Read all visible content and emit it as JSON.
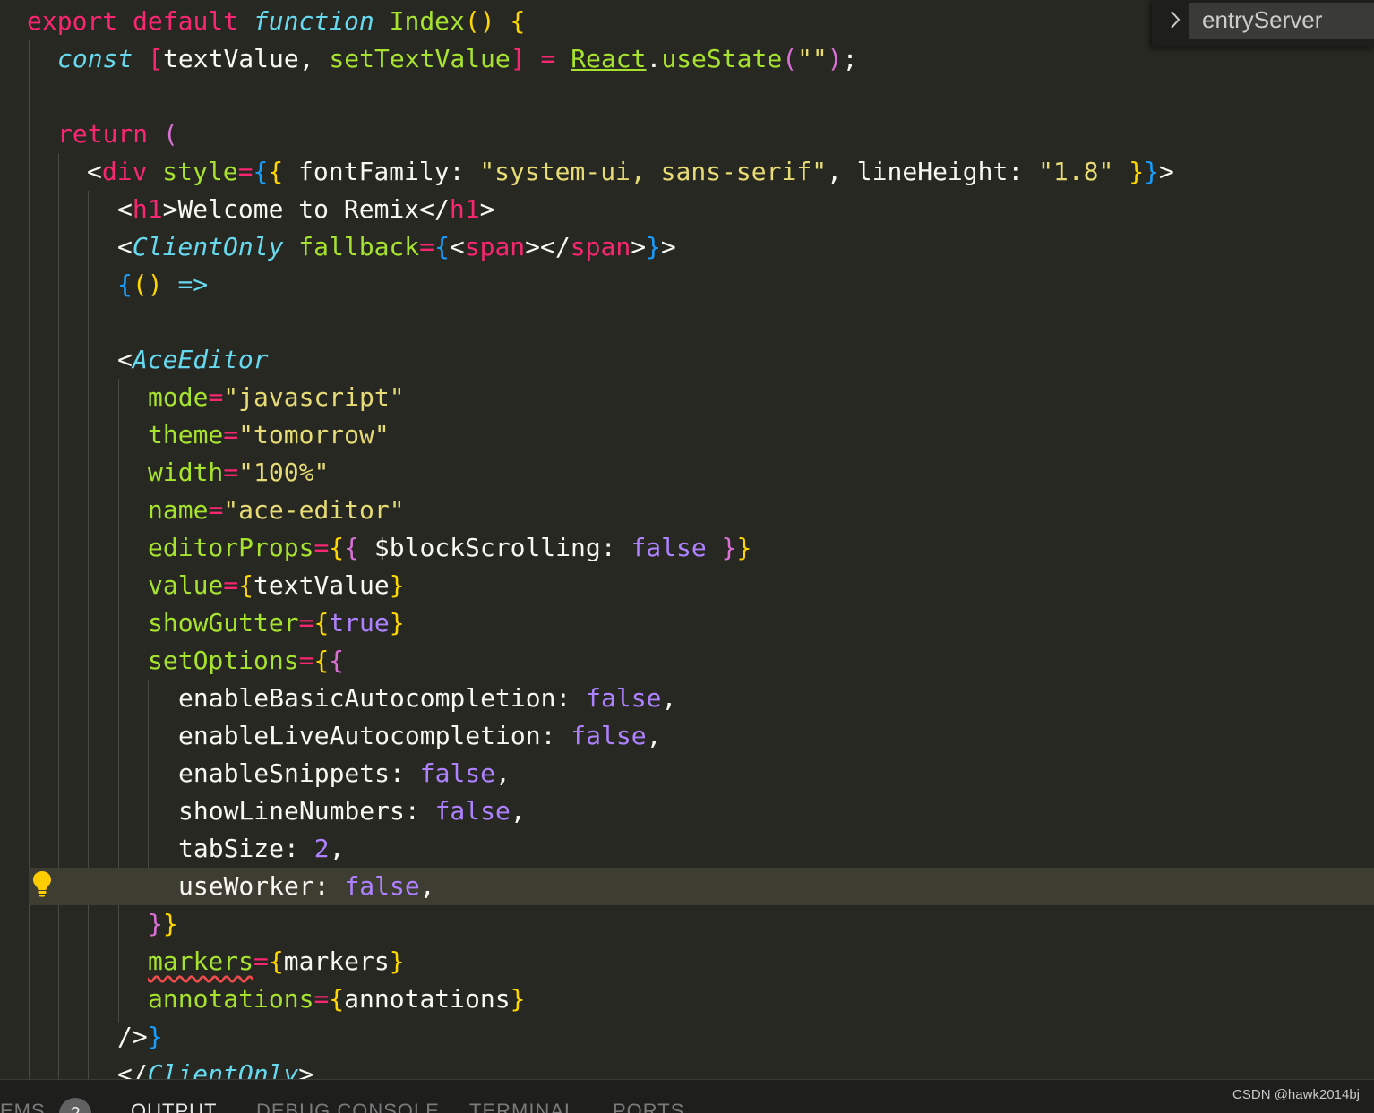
{
  "sticky_scroll": {
    "label": "entryServer"
  },
  "code": {
    "l1": {
      "export": "export",
      "default": "default",
      "function": "function",
      "name": "Index",
      "parens": "()",
      "brace": "{"
    },
    "l2": {
      "const": "const",
      "lb": "[",
      "v1": "textValue",
      "comma": ",",
      "v2": "setTextValue",
      "rb": "]",
      "eq": "=",
      "react": "React",
      "dot": ".",
      "method": "useState",
      "lp": "(",
      "arg": "\"\"",
      "rp": ")",
      "semi": ";"
    },
    "l4": {
      "return": "return",
      "paren": "("
    },
    "l5": {
      "lt": "<",
      "tag": "div",
      "attr": "style",
      "eq": "=",
      "ob": "{",
      "oc": "{",
      "k1": "fontFamily:",
      "v1": "\"system-ui, sans-serif\"",
      "c": ",",
      "k2": "lineHeight:",
      "v2": "\"1.8\"",
      "cc": "}",
      "cb": "}",
      "gt": ">"
    },
    "l6": {
      "lt": "<",
      "tag": "h1",
      "gt": ">",
      "text": "Welcome to Remix",
      "lt2": "</",
      "tag2": "h1",
      "gt2": ">"
    },
    "l7": {
      "lt": "<",
      "comp": "ClientOnly",
      "attr": "fallback",
      "eq": "=",
      "ob": "{",
      "lt2": "<",
      "tag": "span",
      "mid": "></",
      "tag2": "span",
      "gt": ">",
      "cb": "}",
      "gt2": ">"
    },
    "l8": {
      "ob": "{",
      "parens": "()",
      "arrow": "=>"
    },
    "l10": {
      "lt": "<",
      "comp": "AceEditor"
    },
    "l11": {
      "attr": "mode",
      "eq": "=",
      "val": "\"javascript\""
    },
    "l12": {
      "attr": "theme",
      "eq": "=",
      "val": "\"tomorrow\""
    },
    "l13": {
      "attr": "width",
      "eq": "=",
      "val": "\"100%\""
    },
    "l14": {
      "attr": "name",
      "eq": "=",
      "val": "\"ace-editor\""
    },
    "l15": {
      "attr": "editorProps",
      "eq": "=",
      "ob": "{",
      "oc": "{",
      "key": "$blockScrolling:",
      "val": "false",
      "cc": "}",
      "cb": "}"
    },
    "l16": {
      "attr": "value",
      "eq": "=",
      "ob": "{",
      "val": "textValue",
      "cb": "}"
    },
    "l17": {
      "attr": "showGutter",
      "eq": "=",
      "ob": "{",
      "val": "true",
      "cb": "}"
    },
    "l18": {
      "attr": "setOptions",
      "eq": "=",
      "ob": "{",
      "oc": "{"
    },
    "l19": {
      "key": "enableBasicAutocompletion:",
      "val": "false",
      "c": ","
    },
    "l20": {
      "key": "enableLiveAutocompletion:",
      "val": "false",
      "c": ","
    },
    "l21": {
      "key": "enableSnippets:",
      "val": "false",
      "c": ","
    },
    "l22": {
      "key": "showLineNumbers:",
      "val": "false",
      "c": ","
    },
    "l23": {
      "key": "tabSize:",
      "val": "2",
      "c": ","
    },
    "l24": {
      "key": "useWorker:",
      "val": "false",
      "c": ","
    },
    "l25": {
      "cc": "}",
      "cb": "}"
    },
    "l26": {
      "attr": "markers",
      "eq": "=",
      "ob": "{",
      "val": "markers",
      "cb": "}"
    },
    "l27": {
      "attr": "annotations",
      "eq": "=",
      "ob": "{",
      "val": "annotations",
      "cb": "}"
    },
    "l28": {
      "close": "/>",
      "cb": "}"
    },
    "l29": {
      "lt": "</",
      "comp": "ClientOnly",
      "gt": ">"
    }
  },
  "panel": {
    "problems": "EMS",
    "problems_count": "2",
    "output": "OUTPUT",
    "debug_console": "DEBUG CONSOLE",
    "terminal": "TERMINAL",
    "ports": "PORTS"
  },
  "watermark": "CSDN @hawk2014bj",
  "colors": {
    "background": "#272822",
    "keyword": "#f92672",
    "storage": "#66d9ef",
    "function": "#a6e22e",
    "string": "#e6db74",
    "constant": "#ae81ff",
    "bracket_yellow": "#ffd700",
    "bracket_magenta": "#da70d6",
    "bracket_blue": "#179fff"
  },
  "icons": [
    "lightbulb-icon",
    "chevron-right-icon"
  ]
}
